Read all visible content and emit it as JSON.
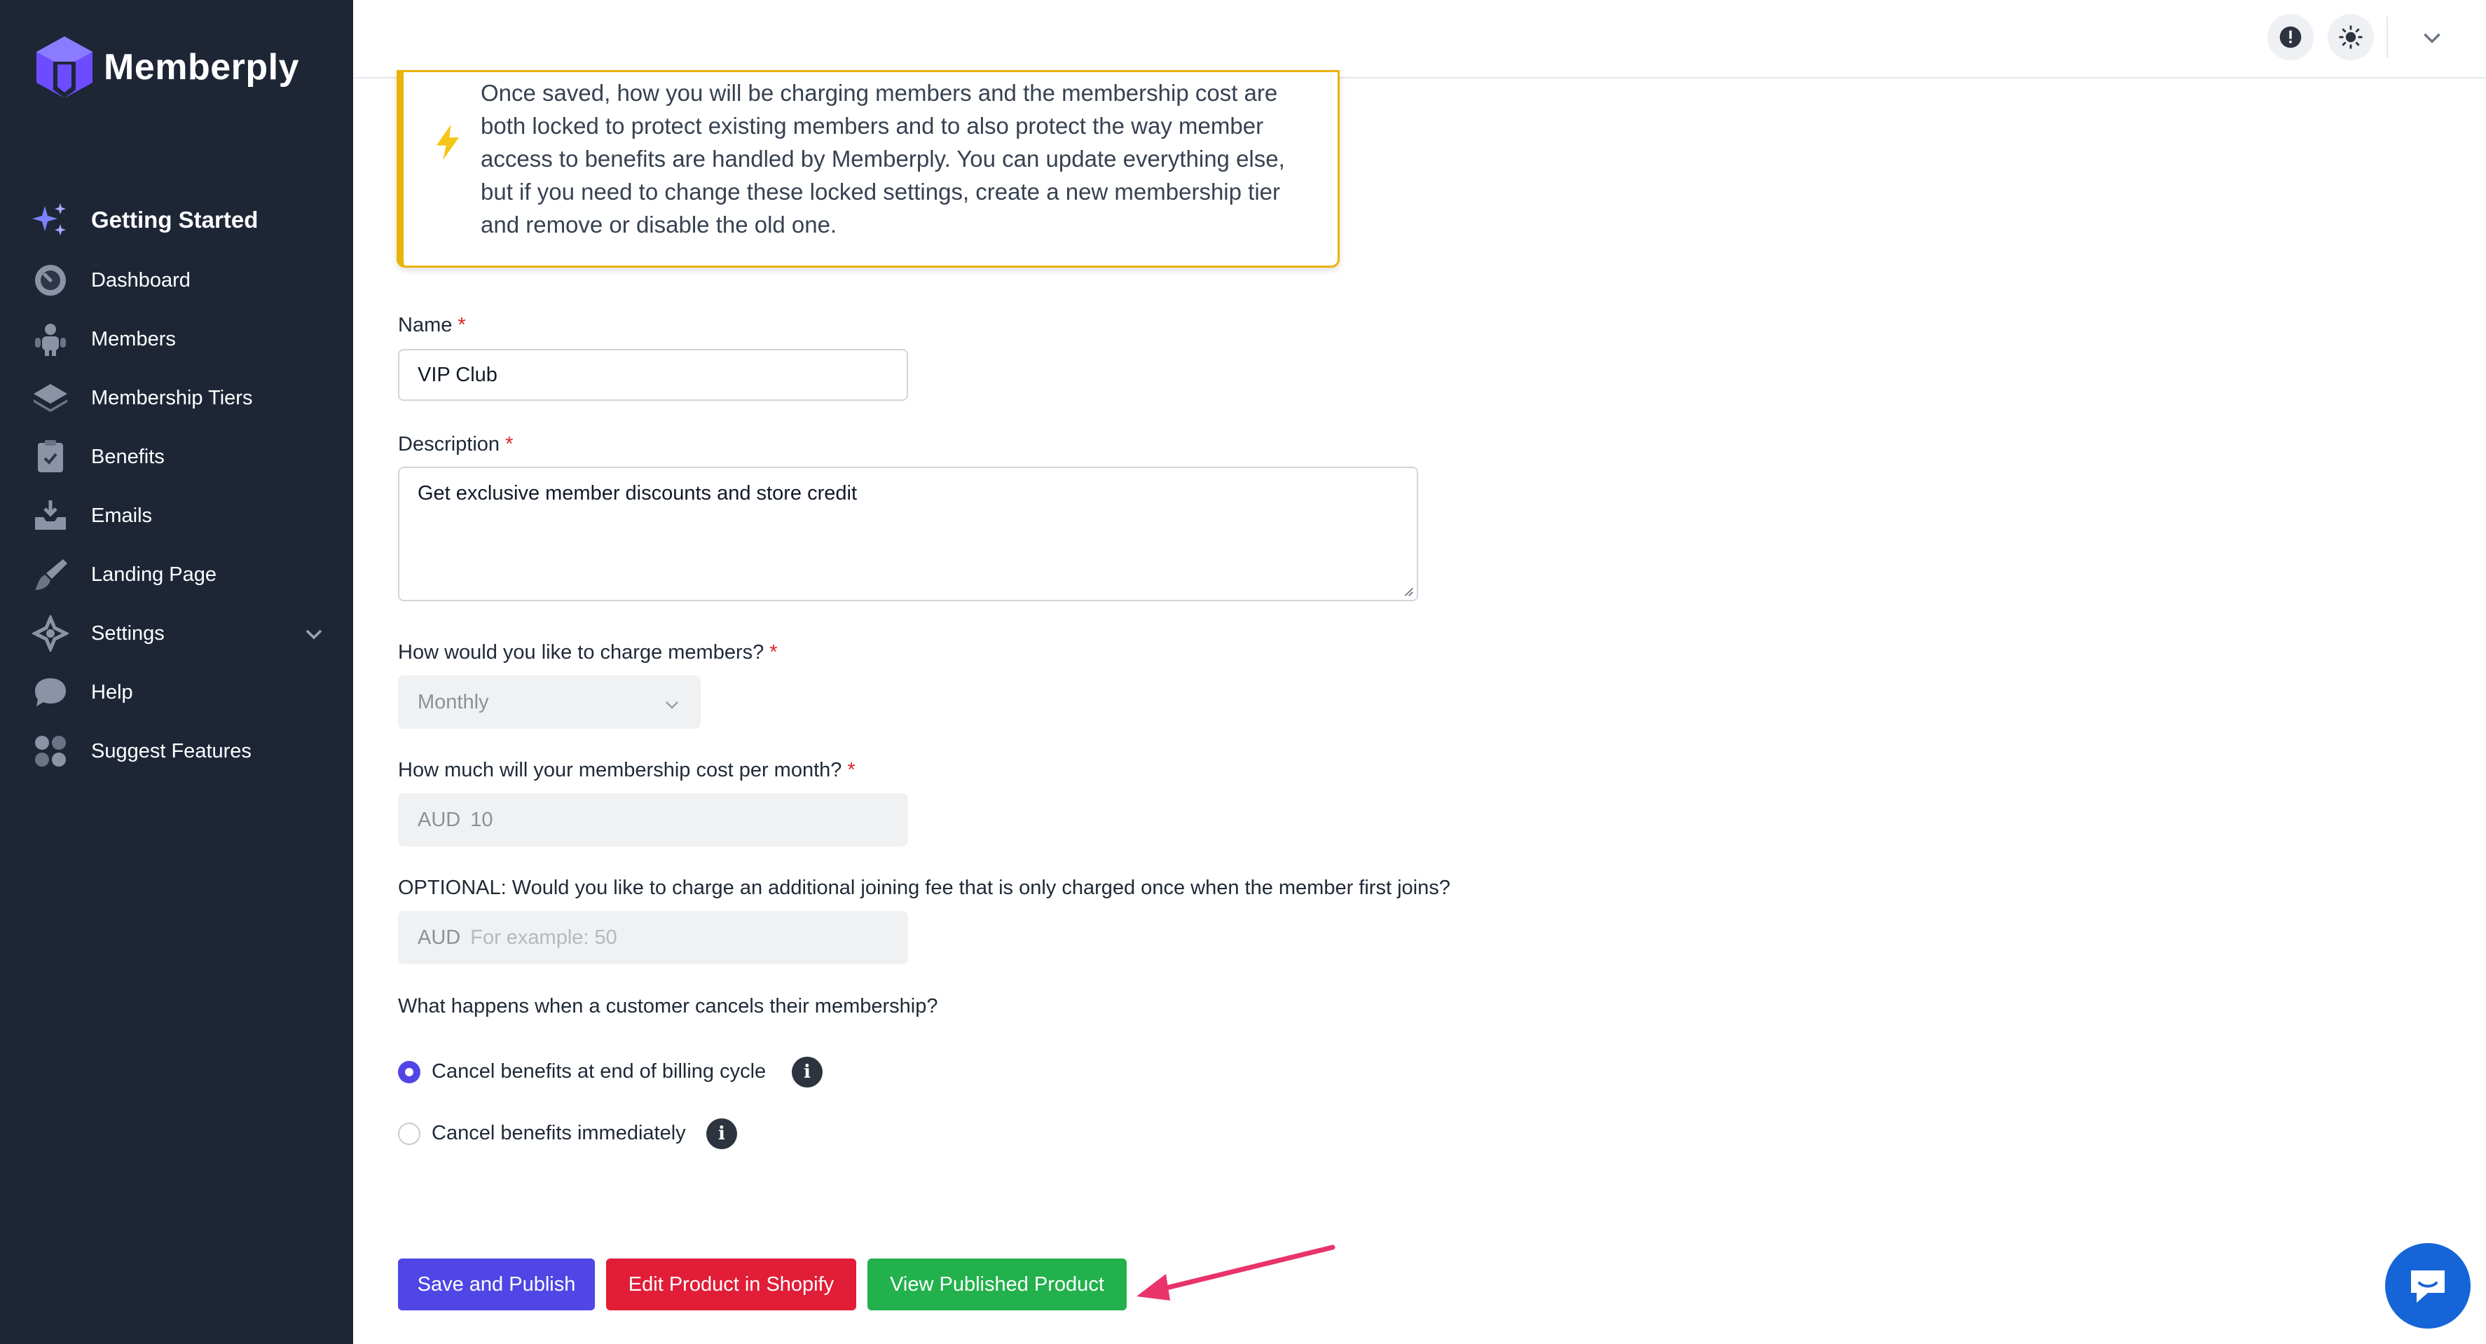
{
  "brand": {
    "name": "Memberply"
  },
  "sidebar": {
    "items": [
      {
        "label": "Getting Started",
        "icon": "sparkles-icon"
      },
      {
        "label": "Dashboard",
        "icon": "gauge-icon"
      },
      {
        "label": "Members",
        "icon": "users-icon"
      },
      {
        "label": "Membership Tiers",
        "icon": "layers-icon"
      },
      {
        "label": "Benefits",
        "icon": "clipboard-check-icon"
      },
      {
        "label": "Emails",
        "icon": "inbox-icon"
      },
      {
        "label": "Landing Page",
        "icon": "brush-icon"
      },
      {
        "label": "Settings",
        "icon": "settings-icon"
      },
      {
        "label": "Help",
        "icon": "chat-bubble-icon"
      },
      {
        "label": "Suggest Features",
        "icon": "grid-dots-icon"
      }
    ]
  },
  "alert": {
    "text": "Once saved, how you will be charging members and the membership cost are both locked to protect existing members and to also protect the way member access to benefits are handled by Memberply. You can update everything else, but if you need to change these locked settings, create a new membership tier and remove or disable the old one."
  },
  "form": {
    "name": {
      "label": "Name",
      "required": "*",
      "value": "VIP Club"
    },
    "description": {
      "label": "Description",
      "required": "*",
      "value": "Get exclusive member discounts and store credit"
    },
    "charge": {
      "label": "How would you like to charge members?",
      "required": "*",
      "value": "Monthly"
    },
    "cost": {
      "label": "How much will your membership cost per month?",
      "required": "*",
      "currency": "AUD",
      "value": "10"
    },
    "joining_fee": {
      "label": "OPTIONAL: Would you like to charge an additional joining fee that is only charged once when the member first joins?",
      "currency": "AUD",
      "placeholder": "For example: 50"
    },
    "cancel": {
      "label": "What happens when a customer cancels their membership?",
      "options": [
        {
          "label": "Cancel benefits at end of billing cycle",
          "checked": true
        },
        {
          "label": "Cancel benefits immediately",
          "checked": false
        }
      ]
    }
  },
  "buttons": {
    "save": "Save and Publish",
    "edit": "Edit Product in Shopify",
    "view": "View Published Product"
  },
  "colors": {
    "sidebar_bg": "#1e2636",
    "primary": "#4f46e5",
    "danger": "#e11d37",
    "success": "#22b14c",
    "alert_border": "#eab308",
    "annotation_arrow": "#e8336b",
    "chat": "#1565d8"
  }
}
